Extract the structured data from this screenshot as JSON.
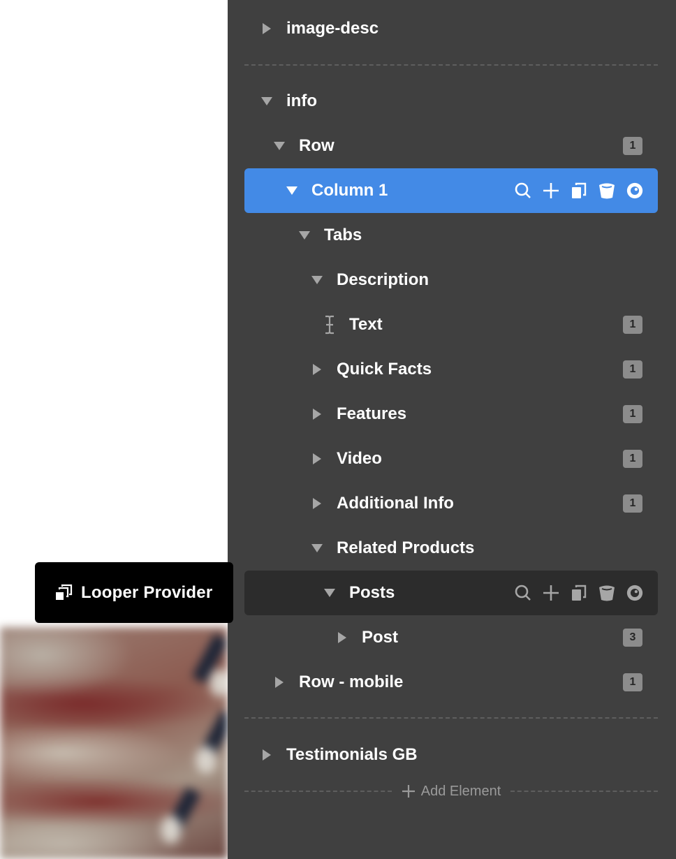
{
  "tooltip": {
    "label": "Looper Provider",
    "icon": "stacked-squares-icon"
  },
  "tree": {
    "nodes": [
      {
        "label": "image-desc",
        "state": "collapsed",
        "badge": null
      },
      {
        "label": "info",
        "state": "expanded",
        "badge": null
      },
      {
        "label": "Row",
        "state": "expanded",
        "badge": "1"
      },
      {
        "label": "Column 1",
        "state": "expanded",
        "badge": null,
        "selected": true
      },
      {
        "label": "Tabs",
        "state": "expanded",
        "badge": null
      },
      {
        "label": "Description",
        "state": "expanded",
        "badge": null
      },
      {
        "label": "Text",
        "state": "leaf",
        "icon": "text-cursor-icon",
        "badge": "1"
      },
      {
        "label": "Quick Facts",
        "state": "collapsed",
        "badge": "1"
      },
      {
        "label": "Features",
        "state": "collapsed",
        "badge": "1"
      },
      {
        "label": "Video",
        "state": "collapsed",
        "badge": "1"
      },
      {
        "label": "Additional Info",
        "state": "collapsed",
        "badge": "1"
      },
      {
        "label": "Related Products",
        "state": "expanded",
        "badge": null
      },
      {
        "label": "Posts",
        "state": "expanded",
        "badge": null,
        "hovered": true
      },
      {
        "label": "Post",
        "state": "collapsed",
        "badge": "3"
      },
      {
        "label": "Row - mobile",
        "state": "collapsed",
        "badge": "1"
      },
      {
        "label": "Testimonials GB",
        "state": "collapsed",
        "badge": null
      }
    ],
    "row_actions": [
      "search-icon",
      "plus-icon",
      "duplicate-icon",
      "trash-icon",
      "eye-icon"
    ]
  },
  "add_element": {
    "label": "Add Element"
  },
  "colors": {
    "panel_bg": "#404040",
    "selected_bg": "#438ae6",
    "hover_bg": "#2c2c2c",
    "badge_bg": "#8c8c8c",
    "caret": "#a6a6a6",
    "text": "#ffffff"
  }
}
